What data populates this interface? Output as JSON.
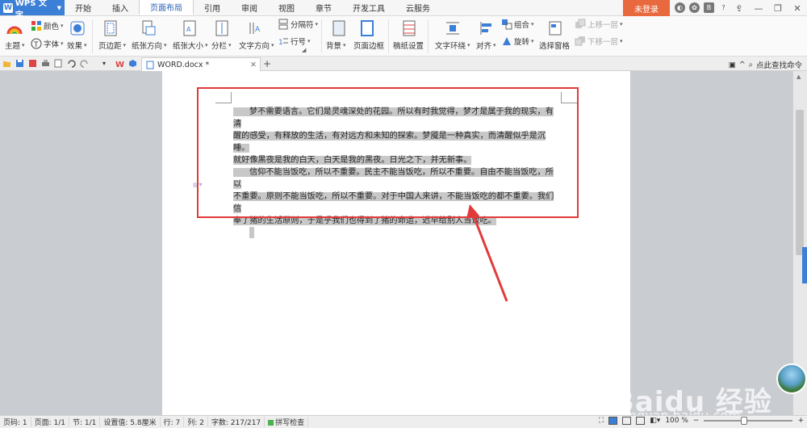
{
  "app": {
    "name": "WPS 文字",
    "login": "未登录"
  },
  "menu": {
    "tabs": [
      "开始",
      "插入",
      "页面布局",
      "引用",
      "审阅",
      "视图",
      "章节",
      "开发工具",
      "云服务"
    ],
    "active": "页面布局"
  },
  "ribbon": {
    "theme": "主题",
    "color": "颜色",
    "font": "字体",
    "effect": "效果",
    "margins": "页边距",
    "orientation": "纸张方向",
    "size": "纸张大小",
    "columns": "分栏",
    "text_direction": "文字方向",
    "breaks": "分隔符",
    "line_numbers": "行号",
    "background": "背景",
    "page_border": "页面边框",
    "manuscript": "稿纸设置",
    "text_wrap": "文字环绕",
    "align": "对齐",
    "group": "组合",
    "rotate": "旋转",
    "selection_pane": "选择窗格",
    "bring_forward": "上移一层",
    "send_backward": "下移一层"
  },
  "doc_tab": {
    "name": "WORD.docx *"
  },
  "search_cmd": "点此查找命令",
  "document": {
    "p1": [
      "梦不需要语言。它们是灵魂深处的花园。所以有时我觉得，梦才是属于我的现实，有清",
      "醒的感受，有释放的生活，有对远方和未知的探索。梦魇是一种真实，而清醒似乎是沉睡。",
      "就好像黑夜是我的白天，白天是我的黑夜。日光之下，并无新事。"
    ],
    "p2": [
      "信仰不能当饭吃，所以不重要。民主不能当饭吃，所以不重要。自由不能当饭吃，所以",
      "不重要。原则不能当饭吃，所以不重要。对于中国人来讲，不能当饭吃的都不重要。我们信",
      "奉了猪的生活原则，于是乎我们也得到了猪的命运，迟早给别人当饭吃。"
    ]
  },
  "status": {
    "page_no": "页码: 1",
    "pages": "页面: 1/1",
    "section": "节: 1/1",
    "setting": "设置值: 5.8厘米",
    "row": "行: 7",
    "col": "列: 2",
    "words": "字数: 217/217",
    "spell": "拼写检查",
    "zoom": "100 %",
    "zoom_fraction": 0.45
  },
  "watermark": {
    "logo": "Baidu 经验",
    "url": "jingyan.baidu.com"
  },
  "colors": {
    "accent": "#3c7fd6",
    "login": "#e8693e",
    "annotation": "#e23a3a",
    "selection": "#c8c8c8"
  }
}
